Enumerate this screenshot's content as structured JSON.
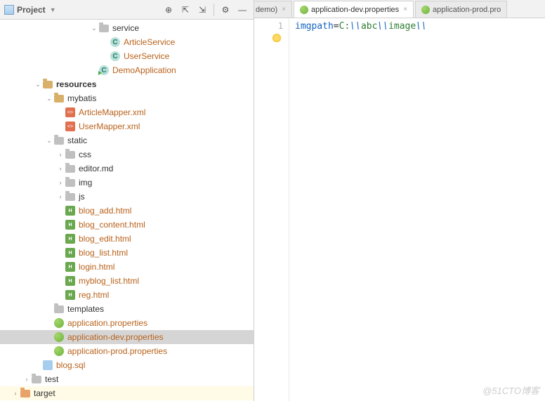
{
  "sidebar": {
    "title": "Project",
    "toolbar": {
      "locate": "⊕",
      "expand": "⇱",
      "collapse": "⇲",
      "settings": "⚙",
      "minimize": "—"
    }
  },
  "tree": [
    {
      "indent": 8,
      "caret": "v",
      "icon": "folder-grey",
      "label": "service",
      "cls": ""
    },
    {
      "indent": 9,
      "caret": "",
      "icon": "class",
      "label": "ArticleService",
      "cls": "code"
    },
    {
      "indent": 9,
      "caret": "",
      "icon": "class",
      "label": "UserService",
      "cls": "code"
    },
    {
      "indent": 8,
      "caret": "",
      "icon": "class-run",
      "label": "DemoApplication",
      "cls": "code"
    },
    {
      "indent": 3,
      "caret": "v",
      "icon": "folder",
      "label": "resources",
      "cls": "bold"
    },
    {
      "indent": 4,
      "caret": "v",
      "icon": "folder",
      "label": "mybatis",
      "cls": ""
    },
    {
      "indent": 5,
      "caret": "",
      "icon": "xml",
      "label": "ArticleMapper.xml",
      "cls": "code"
    },
    {
      "indent": 5,
      "caret": "",
      "icon": "xml",
      "label": "UserMapper.xml",
      "cls": "code"
    },
    {
      "indent": 4,
      "caret": "v",
      "icon": "folder-grey",
      "label": "static",
      "cls": ""
    },
    {
      "indent": 5,
      "caret": ">",
      "icon": "folder-grey",
      "label": "css",
      "cls": ""
    },
    {
      "indent": 5,
      "caret": ">",
      "icon": "folder-grey",
      "label": "editor.md",
      "cls": ""
    },
    {
      "indent": 5,
      "caret": ">",
      "icon": "folder-grey",
      "label": "img",
      "cls": ""
    },
    {
      "indent": 5,
      "caret": ">",
      "icon": "folder-grey",
      "label": "js",
      "cls": ""
    },
    {
      "indent": 5,
      "caret": "",
      "icon": "html",
      "label": "blog_add.html",
      "cls": "code"
    },
    {
      "indent": 5,
      "caret": "",
      "icon": "html",
      "label": "blog_content.html",
      "cls": "code"
    },
    {
      "indent": 5,
      "caret": "",
      "icon": "html",
      "label": "blog_edit.html",
      "cls": "code"
    },
    {
      "indent": 5,
      "caret": "",
      "icon": "html",
      "label": "blog_list.html",
      "cls": "code"
    },
    {
      "indent": 5,
      "caret": "",
      "icon": "html",
      "label": "login.html",
      "cls": "code"
    },
    {
      "indent": 5,
      "caret": "",
      "icon": "html",
      "label": "myblog_list.html",
      "cls": "code"
    },
    {
      "indent": 5,
      "caret": "",
      "icon": "html",
      "label": "reg.html",
      "cls": "code"
    },
    {
      "indent": 4,
      "caret": "",
      "icon": "folder-grey",
      "label": "templates",
      "cls": ""
    },
    {
      "indent": 4,
      "caret": "",
      "icon": "spring",
      "label": "application.properties",
      "cls": "code"
    },
    {
      "indent": 4,
      "caret": "",
      "icon": "spring",
      "label": "application-dev.properties",
      "cls": "code",
      "selected": true
    },
    {
      "indent": 4,
      "caret": "",
      "icon": "spring",
      "label": "application-prod.properties",
      "cls": "code"
    },
    {
      "indent": 3,
      "caret": "",
      "icon": "sql",
      "label": "blog.sql",
      "cls": "code"
    },
    {
      "indent": 2,
      "caret": ">",
      "icon": "folder-grey",
      "label": "test",
      "cls": ""
    },
    {
      "indent": 1,
      "caret": ">",
      "icon": "folder-orange",
      "label": "target",
      "cls": "",
      "target": true
    }
  ],
  "tabs": [
    {
      "label": "demo)",
      "icon": "none",
      "active": false,
      "partial": true
    },
    {
      "label": "application-dev.properties",
      "icon": "spring",
      "active": true
    },
    {
      "label": "application-prod.pro",
      "icon": "spring",
      "active": false,
      "partial_end": true
    }
  ],
  "editor": {
    "line_number": "1",
    "key": "imgpath",
    "eq": "=",
    "val1": "C:",
    "sep1": "\\\\",
    "val2": "abc",
    "sep2": "\\\\",
    "val3": "image",
    "sep3": "\\\\"
  },
  "watermark": "@51CTO博客"
}
